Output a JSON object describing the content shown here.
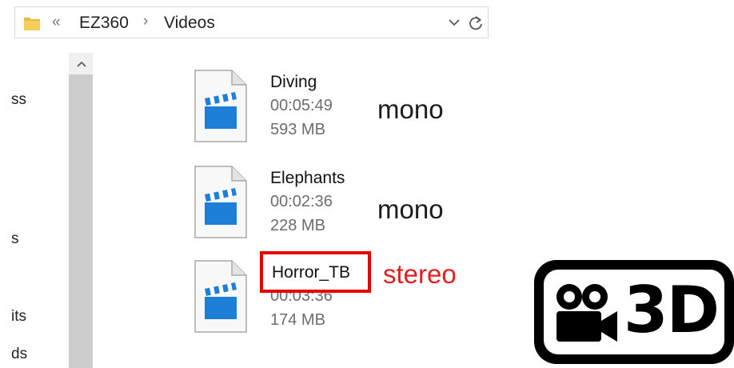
{
  "address_bar": {
    "overflow": "«",
    "crumbs": [
      "EZ360",
      "Videos"
    ],
    "separator": "›",
    "dropdown_icon": "chevron-down-icon",
    "refresh_icon": "refresh-icon"
  },
  "nav_pane": {
    "fragments": [
      "ss",
      "s",
      "its",
      "ds"
    ]
  },
  "files": [
    {
      "name": "Diving",
      "duration": "00:05:49",
      "size": "593 MB",
      "annotation": "mono"
    },
    {
      "name": "Elephants",
      "duration": "00:02:36",
      "size": "228 MB",
      "annotation": "mono"
    },
    {
      "name": "Horror_TB",
      "duration": "00:03:36",
      "size": "174 MB",
      "annotation": "stereo"
    }
  ],
  "badge": {
    "text": "3D",
    "icon": "video-camera-icon"
  },
  "colors": {
    "highlight": "#e60000",
    "stereo": "#e02020",
    "file_icon_blue": "#1e7fd7"
  }
}
